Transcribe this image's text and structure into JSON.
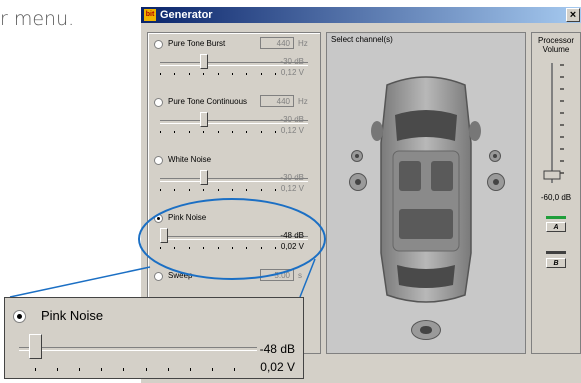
{
  "background_text": "r menu.",
  "window": {
    "title": "Generator",
    "app_icon": "bit-logo-icon",
    "close_label": "×"
  },
  "signals": [
    {
      "label": "Pure Tone Burst",
      "freq": "440",
      "unit": "Hz",
      "db": "-30 dB",
      "volt": "0,12 V",
      "selected": false,
      "level": 0.3
    },
    {
      "label": "Pure Tone Continuous",
      "freq": "440",
      "unit": "Hz",
      "db": "-30 dB",
      "volt": "0,12 V",
      "selected": false,
      "level": 0.3
    },
    {
      "label": "White Noise",
      "db": "-30 dB",
      "volt": "0,12 V",
      "selected": false,
      "level": 0.3
    },
    {
      "label": "Pink Noise",
      "db": "-48 dB",
      "volt": "0,02 V",
      "selected": true,
      "level": 0.02
    },
    {
      "label": "Sweep",
      "freq": "5.00",
      "unit": "s",
      "selected": false
    }
  ],
  "main": {
    "header": "Select channel(s)"
  },
  "processor": {
    "title": "Processor Volume",
    "value": "-60,0 dB",
    "button_a": "A",
    "button_b": "B"
  },
  "callout": {
    "label": "Pink Noise",
    "db": "-48 dB",
    "volt": "0,02 V"
  },
  "colors": {
    "title_start": "#0a246a",
    "title_end": "#a6caf0",
    "callout_ring": "#1b6fc4",
    "led_green": "#1f9e3a"
  }
}
